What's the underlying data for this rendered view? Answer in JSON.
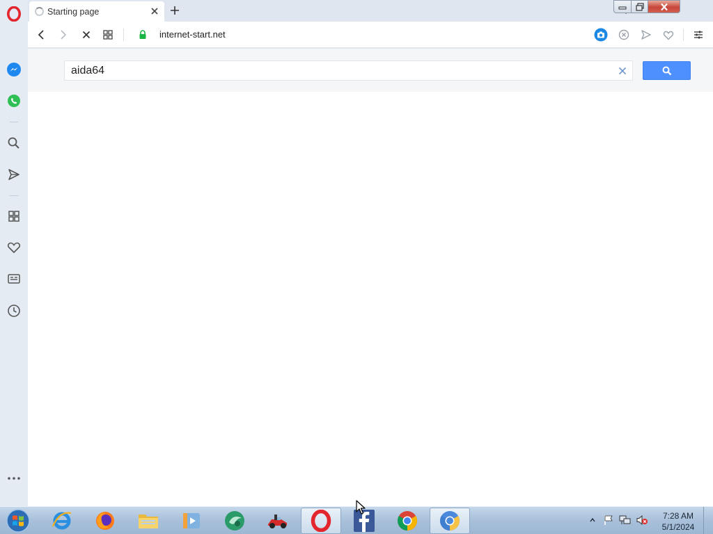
{
  "browser": {
    "tab": {
      "title": "Starting page"
    },
    "address_bar": {
      "url": "internet-start.net"
    }
  },
  "page": {
    "search": {
      "value": "aida64"
    }
  },
  "taskbar": {
    "apps": [
      "internet-explorer",
      "firefox",
      "file-explorer",
      "media-player",
      "app-green",
      "game-app",
      "opera",
      "facebook",
      "chrome",
      "chromium"
    ],
    "clock": {
      "time": "7:28 AM",
      "date": "5/1/2024"
    }
  },
  "colors": {
    "opera_red": "#e3262e",
    "search_button": "#4d90fe",
    "sidebar_bg": "#e4ebf3"
  }
}
